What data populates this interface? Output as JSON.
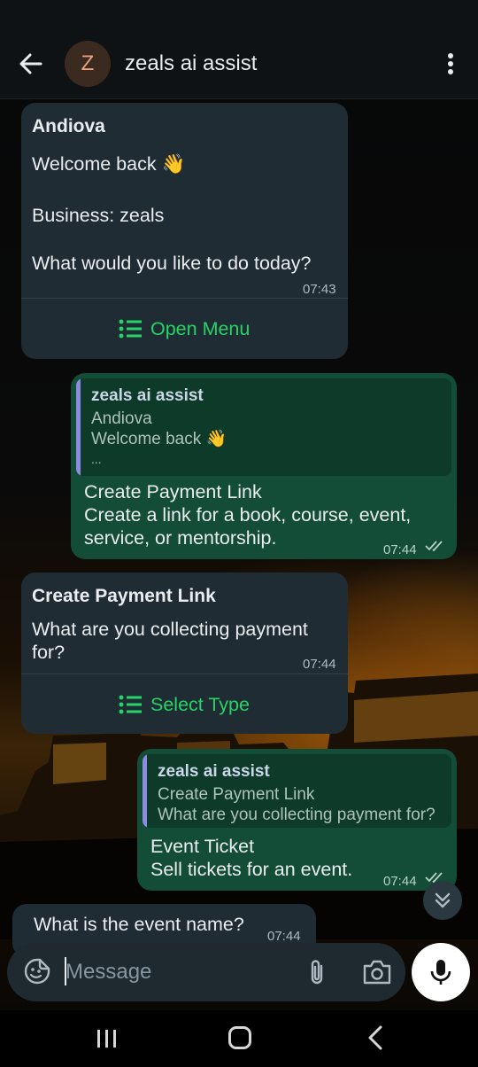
{
  "header": {
    "avatar_letter": "Z",
    "title": "zeals ai assist"
  },
  "messages": {
    "m1": {
      "sender": "Andiova",
      "line1": "Welcome back 👋",
      "line2": "Business: zeals",
      "line3": "What would you like to do today?",
      "time": "07:43",
      "action": "Open Menu"
    },
    "m2": {
      "quote_author": "zeals ai assist",
      "quote_line1": "Andiova",
      "quote_line2": "Welcome back 👋",
      "quote_line3": "...",
      "title": "Create Payment Link",
      "body1": "Create a link for a book, course, event,",
      "body2": "service, or mentorship.",
      "time": "07:44"
    },
    "m3": {
      "sender": "Create Payment Link",
      "line1": "What are you collecting payment",
      "line2": "for?",
      "time": "07:44",
      "action": "Select Type"
    },
    "m4": {
      "quote_author": "zeals ai assist",
      "quote_line1": "Create Payment Link",
      "quote_line2": "What are you collecting payment for?",
      "title": "Event Ticket",
      "body1": "Sell tickets for an event.",
      "time": "07:44"
    },
    "m5": {
      "text": "What is the event name?",
      "time": "07:44"
    }
  },
  "input": {
    "placeholder": "Message"
  },
  "colors": {
    "accent_green": "#25d366",
    "outgoing_bubble": "#144d37",
    "incoming_bubble": "#202c33",
    "quote_bar": "#8c8be0"
  },
  "icons": [
    "back-arrow-icon",
    "more-vert-icon",
    "list-icon",
    "double-check-icon",
    "chevrons-down-icon",
    "sticker-icon",
    "attach-icon",
    "camera-icon",
    "mic-icon",
    "recent-apps-icon",
    "home-icon",
    "nav-back-icon"
  ]
}
